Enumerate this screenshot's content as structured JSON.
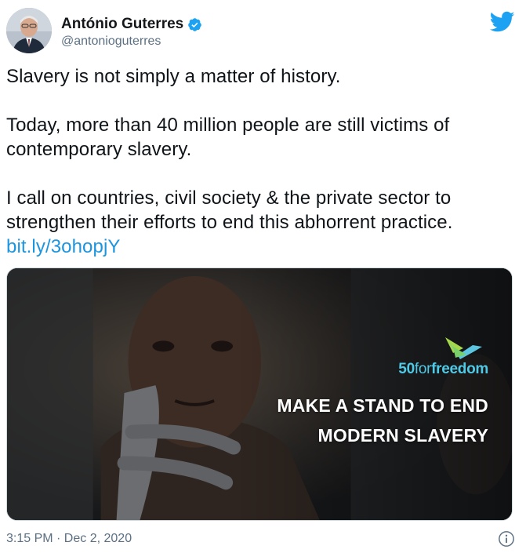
{
  "author": {
    "display_name": "António Guterres",
    "handle": "@antonioguterres"
  },
  "tweet": {
    "line1": "Slavery is not simply a matter of history.",
    "line2": "Today, more than 40 million people are still victims of contemporary slavery.",
    "line3": "I call on countries, civil society & the private sector to strengthen their efforts to end this abhorrent practice.",
    "link": "bit.ly/3ohopjY"
  },
  "media": {
    "brand_number": "50",
    "brand_for": "for",
    "brand_freedom": "freedom",
    "headline_line1": "MAKE A STAND TO END",
    "headline_line2": "MODERN SLAVERY"
  },
  "footer": {
    "timestamp": "3:15 PM · Dec 2, 2020"
  },
  "colors": {
    "link": "#1b95e0",
    "verified": "#1da1f2",
    "brand": "#4ec9e6"
  },
  "icons": [
    "verified-badge-icon",
    "twitter-bird-icon",
    "info-icon"
  ]
}
